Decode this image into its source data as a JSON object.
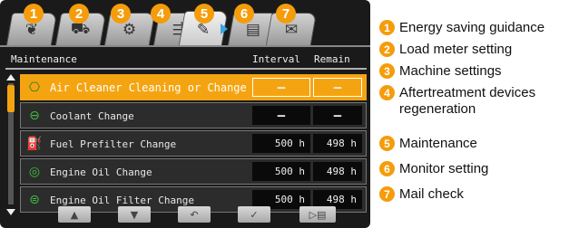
{
  "tabs": [
    {
      "number": "1",
      "icon": "leaf-icon",
      "glyph": "❦",
      "label": "Energy saving guidance"
    },
    {
      "number": "2",
      "icon": "load-meter-icon",
      "glyph": "⛟",
      "label": "Load meter setting"
    },
    {
      "number": "3",
      "icon": "machine-settings-icon",
      "glyph": "⚙",
      "label": "Machine settings"
    },
    {
      "number": "4",
      "icon": "aftertreatment-icon",
      "glyph": "⇶",
      "label": "Aftertreatment devices regeneration"
    },
    {
      "number": "5",
      "icon": "maintenance-icon",
      "glyph": "✎",
      "label": "Maintenance"
    },
    {
      "number": "6",
      "icon": "monitor-setting-icon",
      "glyph": "▤",
      "label": "Monitor setting"
    },
    {
      "number": "7",
      "icon": "mail-icon",
      "glyph": "✉",
      "label": "Mail check"
    }
  ],
  "header": {
    "title": "Maintenance",
    "interval": "Interval",
    "remain": "Remain"
  },
  "rows": [
    {
      "icon": "air-cleaner-icon",
      "glyph": "⎔",
      "label": "Air Cleaner Cleaning or Change",
      "interval": "—",
      "remain": "—",
      "selected": true
    },
    {
      "icon": "coolant-icon",
      "glyph": "⊖",
      "label": "Coolant Change",
      "interval": "—",
      "remain": "—",
      "selected": false
    },
    {
      "icon": "fuel-prefilter-icon",
      "glyph": "⛽",
      "label": "Fuel Prefilter Change",
      "interval": "500 h",
      "remain": "498 h",
      "selected": false
    },
    {
      "icon": "engine-oil-icon",
      "glyph": "◎",
      "label": "Engine Oil Change",
      "interval": "500 h",
      "remain": "498 h",
      "selected": false
    },
    {
      "icon": "oil-filter-icon",
      "glyph": "⊜",
      "label": "Engine Oil Filter Change",
      "interval": "500 h",
      "remain": "498 h",
      "selected": false
    }
  ],
  "buttons": [
    {
      "name": "scroll-up-button",
      "icon": "arrow-up-icon",
      "glyph": "▲"
    },
    {
      "name": "scroll-down-button",
      "icon": "arrow-down-icon",
      "glyph": "▼"
    },
    {
      "name": "back-button",
      "icon": "return-icon",
      "glyph": "↶"
    },
    {
      "name": "confirm-button",
      "icon": "check-icon",
      "glyph": "✓"
    },
    {
      "name": "next-tab-button",
      "icon": "next-tab-icon",
      "glyph": "▷▤"
    }
  ],
  "colors": {
    "accent": "#f5a411",
    "badge": "#f59c0b",
    "row_icon": "#3fbf3f",
    "cursor": "#39a6e6"
  }
}
